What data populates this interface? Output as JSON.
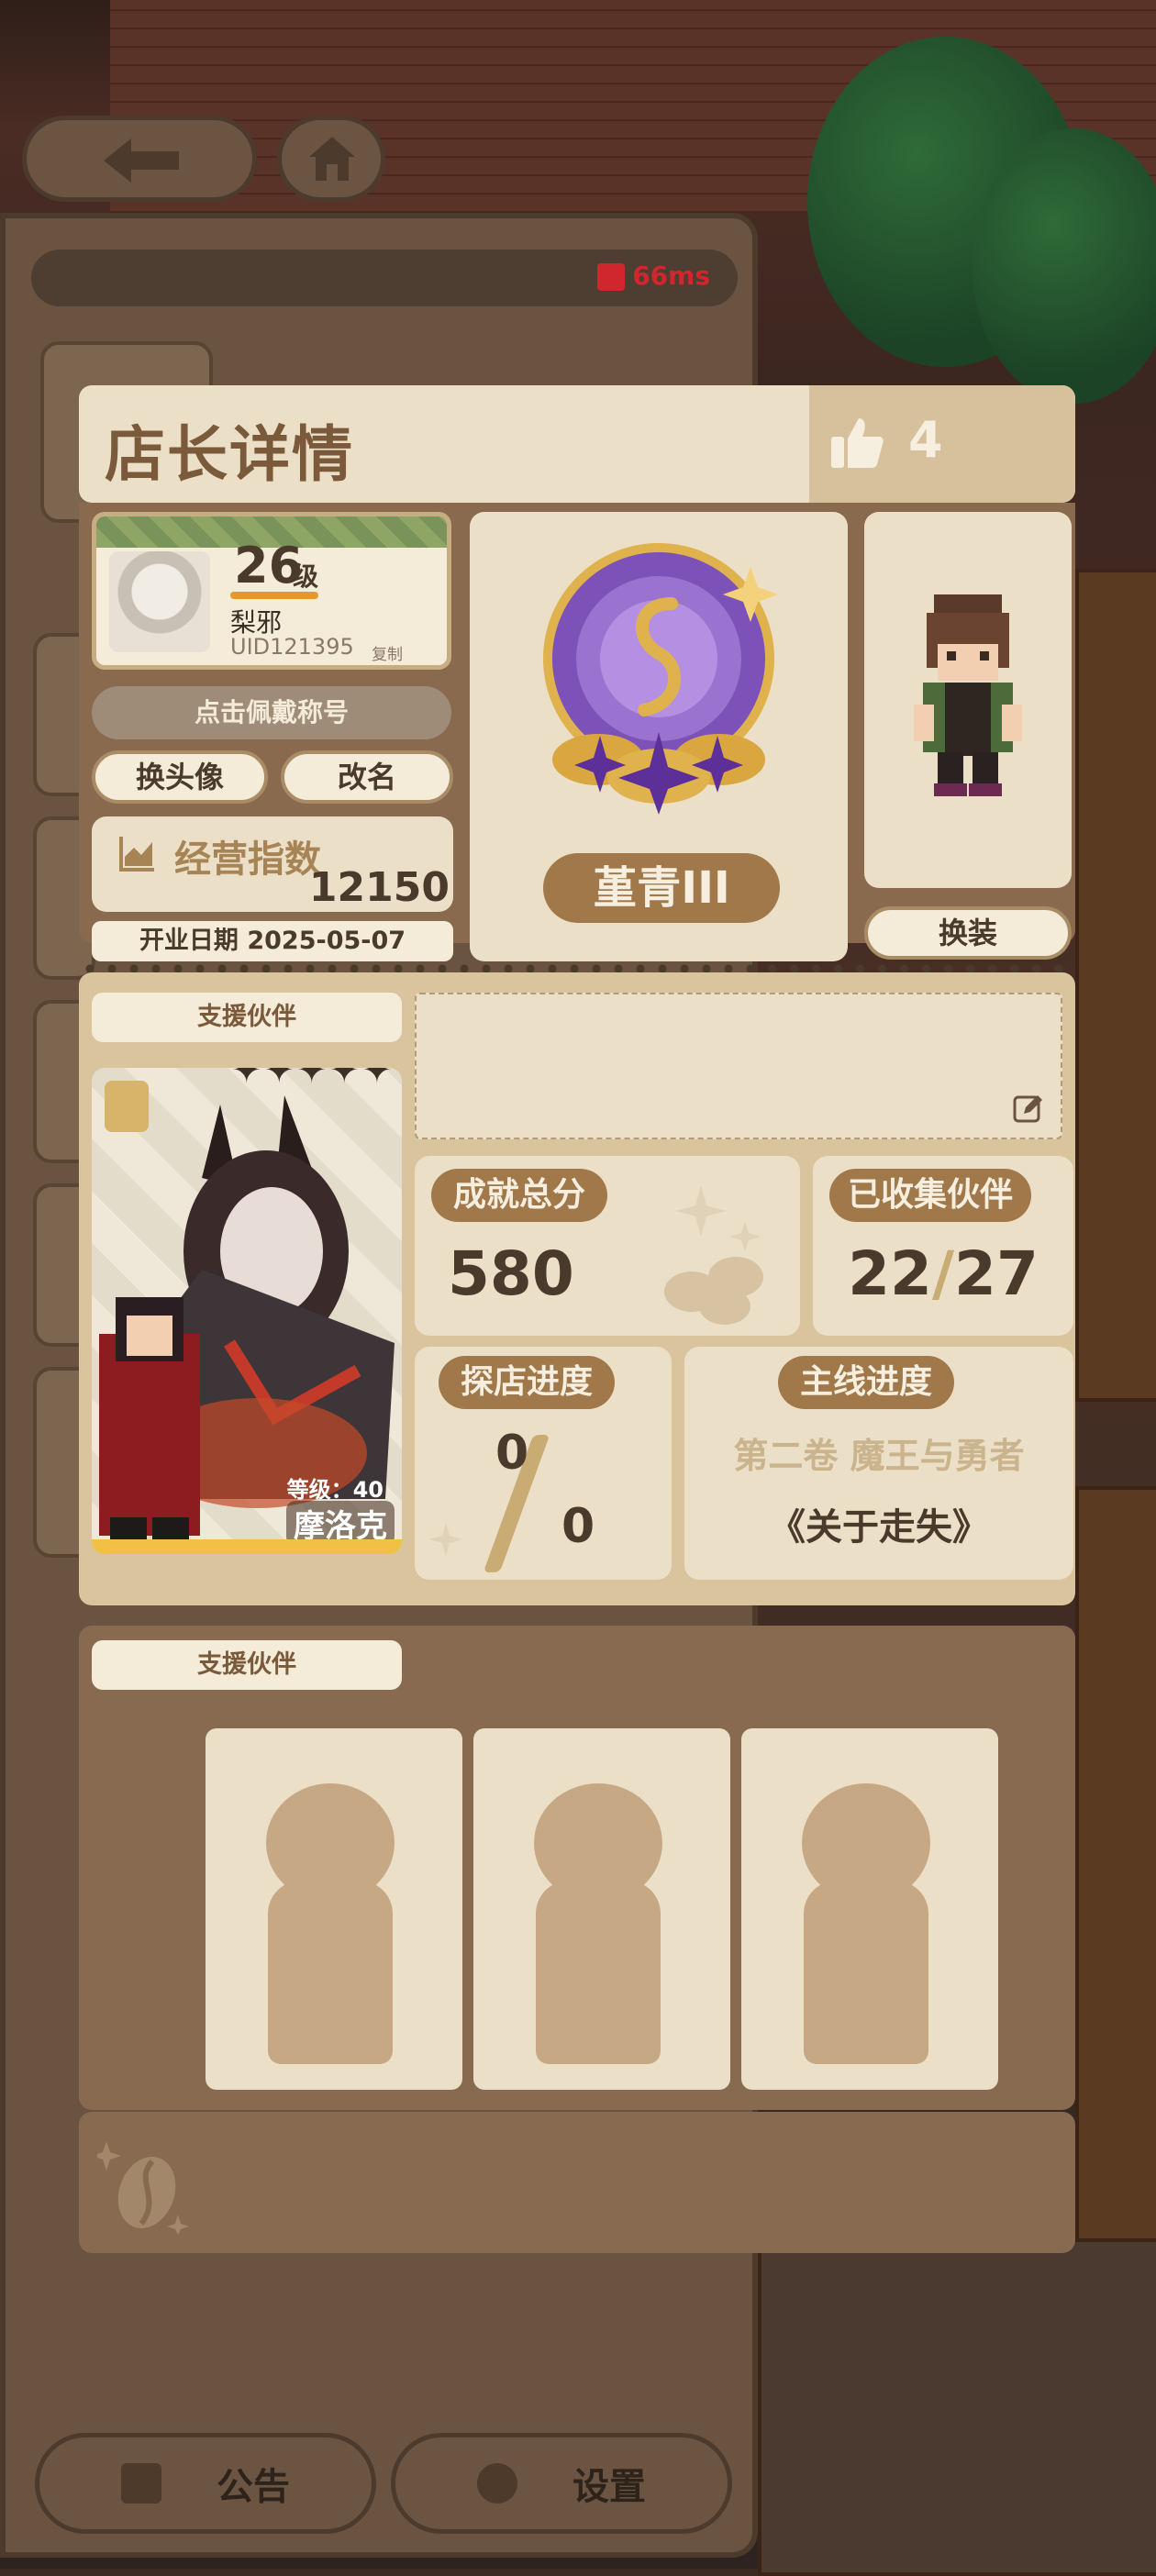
{
  "network": {
    "latency": "66ms",
    "signal_icon": "signal-bars-icon"
  },
  "nav": {
    "back_icon": "arrow-left-icon",
    "home_icon": "home-icon"
  },
  "bottom_bar": {
    "notice": "公告",
    "settings": "设置"
  },
  "header": {
    "title": "店长详情",
    "likes": "4"
  },
  "profile": {
    "level": "26",
    "level_unit": "级",
    "name": "梨邪",
    "uid": "UID121395",
    "copy": "复制",
    "wear_title": "点击佩戴称号",
    "change_avatar": "换头像",
    "rename": "改名",
    "score_label": "经营指数",
    "score_value": "12150",
    "open_date": "开业日期 2025-05-07"
  },
  "badge": {
    "name": "堇青III",
    "colors": {
      "purple": "#7c52b8",
      "gold": "#e0b24e"
    }
  },
  "outfit": {
    "button": "换装"
  },
  "support": {
    "label": "支援伙伴",
    "partner_stars": "✦✦✦✦✦",
    "partner_level": "等级：40",
    "partner_name": "摩洛克"
  },
  "stats": {
    "total_label": "成就总分",
    "total_value": "580",
    "collected_label": "已收集伙伴",
    "collected_have": "22",
    "collected_sep": "/",
    "collected_total": "27",
    "explore_label": "探店进度",
    "explore_done": "0",
    "explore_total": "0",
    "story_label": "主线进度",
    "story_chapter": "第二卷 魔王与勇者",
    "story_title": "《关于走失》"
  },
  "support2": {
    "label": "支援伙伴",
    "slots": 3
  },
  "colors": {
    "accent": "#a0784a",
    "panel": "#ebdfc7",
    "frame": "#8a6a4e"
  }
}
